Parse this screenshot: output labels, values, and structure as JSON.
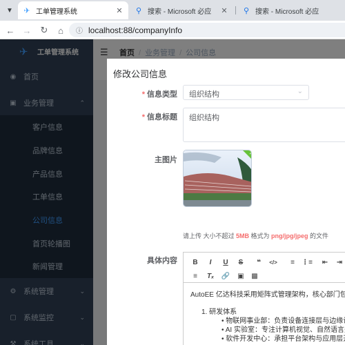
{
  "browser": {
    "tabs": [
      {
        "title": "工单管理系统",
        "active": true
      },
      {
        "title": "搜索 - Microsoft 必应",
        "active": false
      },
      {
        "title": "搜索 - Microsoft 必应",
        "active": false
      }
    ],
    "url": "localhost:88/companyInfo"
  },
  "sidebar": {
    "app_title": "工单管理系统",
    "menu": [
      {
        "label": "首页",
        "icon": "dashboard-icon"
      },
      {
        "label": "业务管理",
        "icon": "cart-icon",
        "expanded": true
      },
      {
        "label": "系统管理",
        "icon": "gear-icon"
      },
      {
        "label": "系统监控",
        "icon": "monitor-icon"
      },
      {
        "label": "系统工具",
        "icon": "tools-icon"
      }
    ],
    "submenu": [
      {
        "label": "客户信息"
      },
      {
        "label": "品牌信息"
      },
      {
        "label": "产品信息"
      },
      {
        "label": "工单信息"
      },
      {
        "label": "公司信息",
        "active": true
      },
      {
        "label": "首页轮播图"
      },
      {
        "label": "新闻管理"
      }
    ],
    "colors": {
      "bg": "#304156",
      "submenu_bg": "#1f2d3d",
      "active": "#409eff"
    }
  },
  "header": {
    "breadcrumb": [
      "首页",
      "业务管理",
      "公司信息"
    ]
  },
  "dialog": {
    "title": "修改公司信息",
    "fields": {
      "info_type": {
        "label": "信息类型",
        "value": "组织结构"
      },
      "info_title": {
        "label": "信息标题",
        "value": "组织结构"
      },
      "main_image": {
        "label": "主图片"
      },
      "content": {
        "label": "具体内容"
      }
    },
    "upload_tip": {
      "prefix": "请上传 大小不超过 ",
      "size": "5MB",
      "middle": " 格式为 ",
      "formats": "png/jpg/jpeg",
      "suffix": " 的文件"
    },
    "editor": {
      "toolbar_row1": [
        "B",
        "I",
        "U",
        "S",
        "99",
        "</>",
        "ol",
        "ul",
        "outdent",
        "indent"
      ],
      "toolbar_row2": [
        "align",
        "clear-format",
        "link",
        "image",
        "video"
      ],
      "lines": {
        "intro": "AutoEE 亿达科技采用矩阵式管理架构，核心部门包括：",
        "section1": "1. 研发体系",
        "item1": "• 物联网事业部：负责设备连接层与边缘计算技术",
        "item2": "• AI 实验室：专注计算机视觉、自然语言处理技术",
        "item3": "• 软件开发中心：承担平台架构与应用层开发"
      }
    }
  }
}
